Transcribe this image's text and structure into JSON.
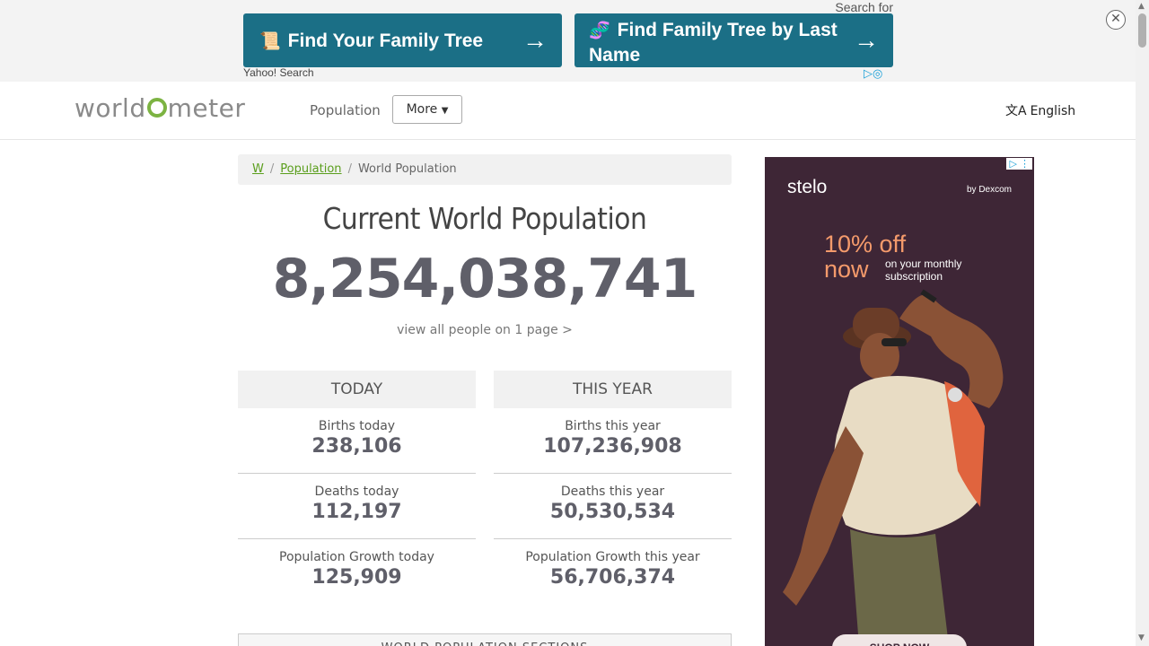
{
  "top_ad": {
    "search_for": "Search for",
    "button1": {
      "icon": "scroll-icon",
      "label": "Find Your Family Tree"
    },
    "button2": {
      "icon": "dna-icon",
      "label": "Find Family Tree by Last Name"
    },
    "provider": "Yahoo! Search"
  },
  "header": {
    "logo": {
      "part1": "world",
      "part2": "meter"
    },
    "nav_population": "Population",
    "more_label": "More",
    "language": "English"
  },
  "breadcrumb": {
    "home": "W",
    "population": "Population",
    "current": "World Population"
  },
  "main": {
    "title": "Current World Population",
    "counter": "8,254,038,741",
    "view_all": "view all people on 1 page >"
  },
  "today": {
    "heading": "TODAY",
    "stats": [
      {
        "label": "Births today",
        "value": "238,106"
      },
      {
        "label": "Deaths today",
        "value": "112,197"
      },
      {
        "label": "Population Growth today",
        "value": "125,909"
      }
    ]
  },
  "this_year": {
    "heading": "THIS YEAR",
    "stats": [
      {
        "label": "Births this year",
        "value": "107,236,908"
      },
      {
        "label": "Deaths this year",
        "value": "50,530,534"
      },
      {
        "label": "Population Growth this year",
        "value": "56,706,374"
      }
    ]
  },
  "sections_box": "WORLD POPULATION SECTIONS",
  "side_ad": {
    "brand": "stelo",
    "by": "by Dexcom",
    "offer_line1": "10% off",
    "offer_line2": "now",
    "sub_line1": "on your monthly",
    "sub_line2": "subscription",
    "cta": "SHOP NOW"
  },
  "colors": {
    "ad_button": "#1b6f86",
    "accent_green": "#7cb342",
    "counter": "#5f5f69",
    "side_ad_bg": "#3e2636",
    "side_ad_offer": "#f49a6b"
  }
}
